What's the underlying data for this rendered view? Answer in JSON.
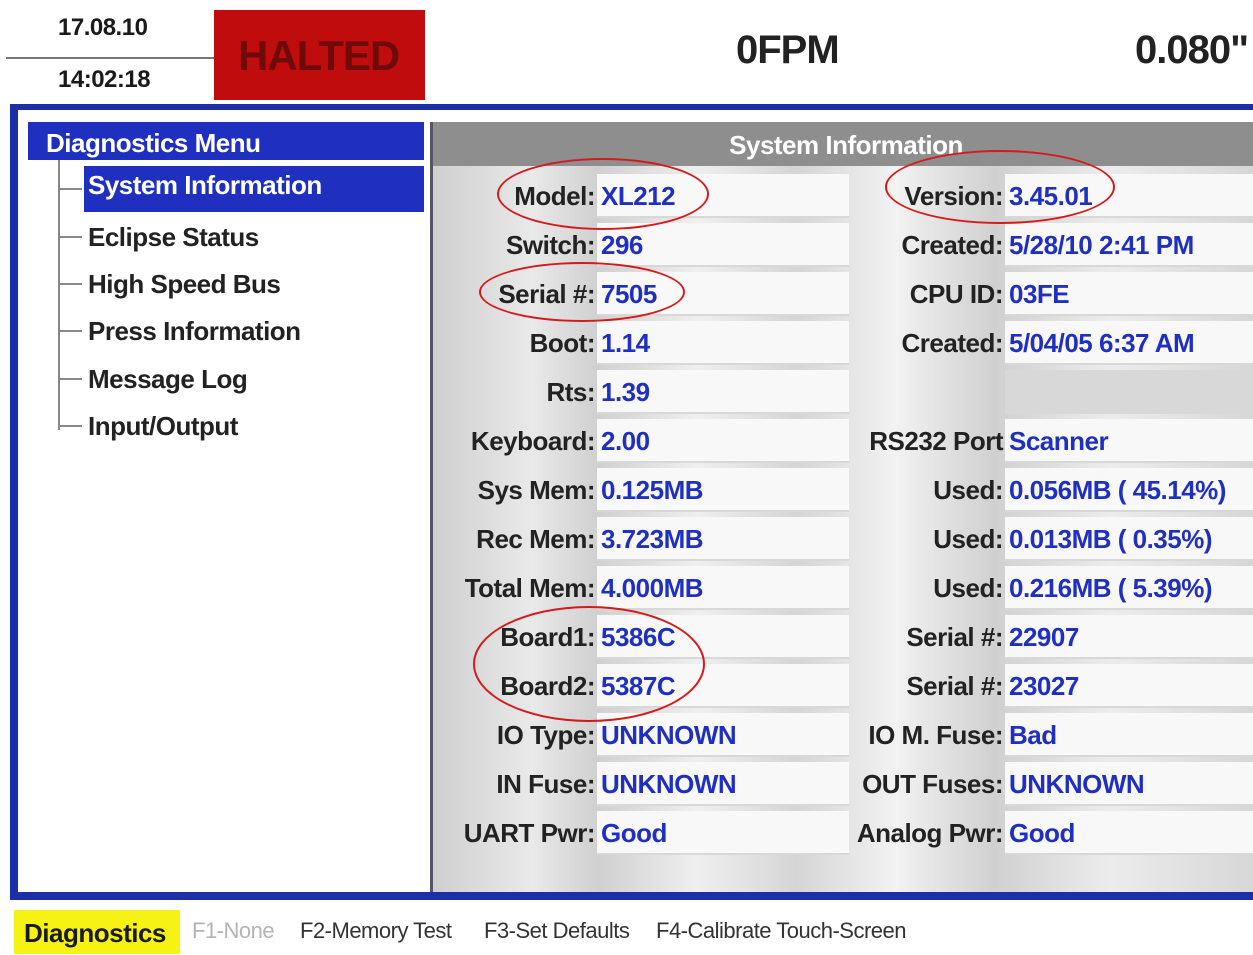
{
  "header": {
    "date": "17.08.10",
    "time": "14:02:18",
    "status": "HALTED",
    "speed": "0FPM",
    "thickness": "0.080\""
  },
  "menu": {
    "title": "Diagnostics Menu",
    "items": [
      {
        "label": "System Information",
        "selected": true
      },
      {
        "label": "Eclipse Status"
      },
      {
        "label": "High Speed Bus"
      },
      {
        "label": "Press Information"
      },
      {
        "label": "Message Log"
      },
      {
        "label": "Input/Output"
      }
    ]
  },
  "system_info": {
    "title": "System Information",
    "left": [
      {
        "label": "Model:",
        "value": "XL212"
      },
      {
        "label": "Switch:",
        "value": "296"
      },
      {
        "label": "Serial #:",
        "value": "7505"
      },
      {
        "label": "Boot:",
        "value": "1.14"
      },
      {
        "label": "Rts:",
        "value": "1.39"
      },
      {
        "label": "Keyboard:",
        "value": "2.00"
      },
      {
        "label": "Sys Mem:",
        "value": "0.125MB"
      },
      {
        "label": "Rec Mem:",
        "value": "3.723MB"
      },
      {
        "label": "Total Mem:",
        "value": "4.000MB"
      },
      {
        "label": "Board1:",
        "value": "5386C"
      },
      {
        "label": "Board2:",
        "value": "5387C"
      },
      {
        "label": "IO Type:",
        "value": "UNKNOWN"
      },
      {
        "label": "IN Fuse:",
        "value": "UNKNOWN"
      },
      {
        "label": "UART Pwr:",
        "value": "Good"
      }
    ],
    "right": [
      {
        "label": "Version:",
        "value": "3.45.01"
      },
      {
        "label": "Created:",
        "value": "5/28/10 2:41 PM"
      },
      {
        "label": "CPU ID:",
        "value": "03FE"
      },
      {
        "label": "Created:",
        "value": "5/04/05 6:37 AM"
      },
      {
        "label": "",
        "value": ""
      },
      {
        "label": "RS232 Port",
        "value": "Scanner"
      },
      {
        "label": "Used:",
        "value": "0.056MB ( 45.14%)"
      },
      {
        "label": "Used:",
        "value": "0.013MB (  0.35%)"
      },
      {
        "label": "Used:",
        "value": "0.216MB (  5.39%)"
      },
      {
        "label": "Serial #:",
        "value": "22907"
      },
      {
        "label": "Serial #:",
        "value": "23027"
      },
      {
        "label": "IO M. Fuse:",
        "value": "Bad"
      },
      {
        "label": "OUT Fuses:",
        "value": "UNKNOWN"
      },
      {
        "label": "Analog Pwr:",
        "value": "Good"
      }
    ]
  },
  "footer": {
    "mode": "Diagnostics",
    "f1": "F1-None",
    "f2": "F2-Memory Test",
    "f3": "F3-Set Defaults",
    "f4": "F4-Calibrate Touch-Screen"
  },
  "colors": {
    "accent_blue": "#1f2fc0",
    "halted_red": "#c00c0c",
    "mode_yellow": "#f6f213",
    "annotation_red": "#d51a1a"
  }
}
